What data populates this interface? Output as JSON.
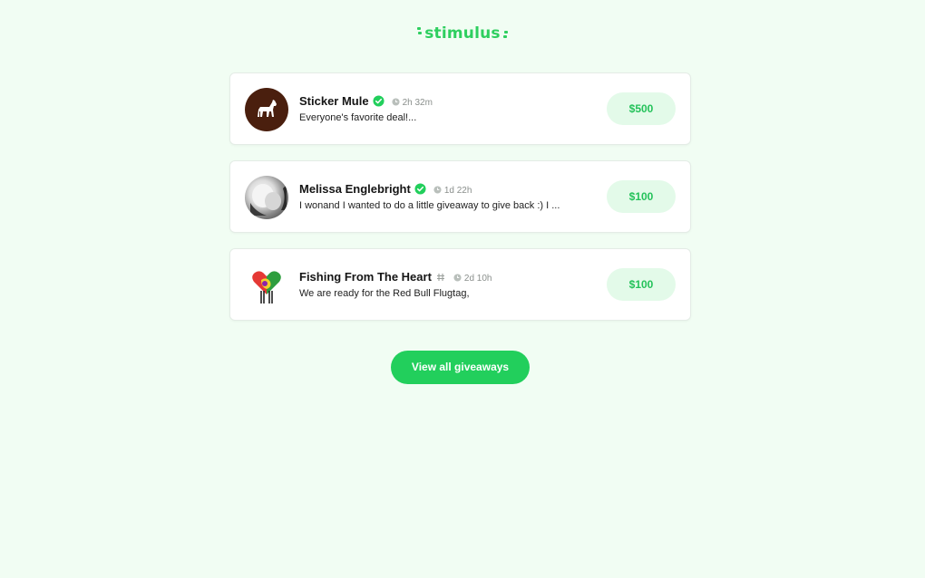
{
  "brand": {
    "logo_text": "stimulus",
    "accent_color": "#22cf5c"
  },
  "giveaways": [
    {
      "name": "Sticker Mule",
      "badge": "verified-check-icon",
      "time": "2h 32m",
      "description": "Everyone's favorite deal!...",
      "amount": "$500",
      "avatar": "horse-logo-avatar"
    },
    {
      "name": "Melissa Englebright",
      "badge": "verified-check-icon",
      "time": "1d 22h",
      "description": "I wonand I wanted to do a little giveaway to give back :) I ...",
      "amount": "$100",
      "avatar": "photo-avatar"
    },
    {
      "name": "Fishing From The Heart",
      "badge": "hash-icon",
      "time": "2d 10h",
      "description": "We are ready for the Red Bull Flugtag,",
      "amount": "$100",
      "avatar": "heart-logo-avatar"
    }
  ],
  "footer": {
    "view_all_label": "View all giveaways"
  }
}
